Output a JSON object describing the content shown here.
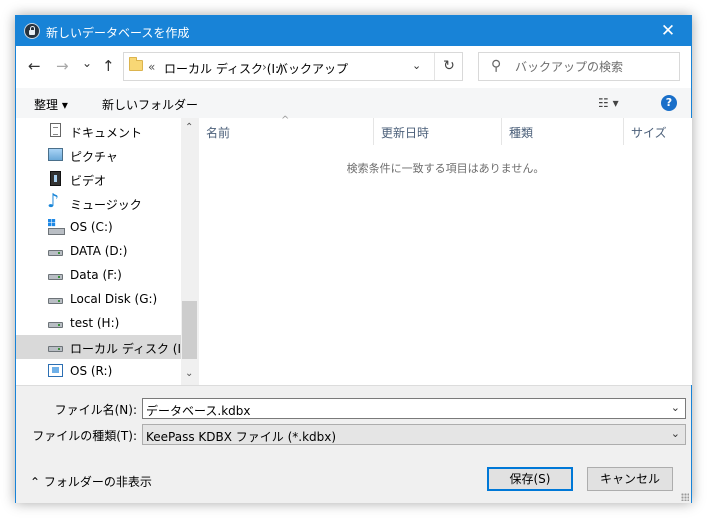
{
  "window": {
    "title": "新しいデータベースを作成",
    "close_icon": "close-icon"
  },
  "nav": {
    "back": "←",
    "forward": "→",
    "recent": "⌄",
    "up": "↑",
    "address": {
      "overflow": "«",
      "drive": "ローカル ディスク (I:)",
      "sep": "›",
      "folder": "バックアップ",
      "dropdown": "⌄",
      "refresh": "↻"
    },
    "search": {
      "placeholder": "バックアップの検索",
      "icon": "⚲"
    }
  },
  "toolbar": {
    "organize": "整理 ▾",
    "new_folder": "新しいフォルダー",
    "view": "☷ ▾",
    "help": "?"
  },
  "sidebar": {
    "items": [
      {
        "label": "ドキュメント",
        "icon": "document-icon"
      },
      {
        "label": "ピクチャ",
        "icon": "pictures-icon"
      },
      {
        "label": "ビデオ",
        "icon": "videos-icon"
      },
      {
        "label": "ミュージック",
        "icon": "music-icon"
      },
      {
        "label": "OS (C:)",
        "icon": "windows-drive-icon"
      },
      {
        "label": "DATA (D:)",
        "icon": "drive-icon"
      },
      {
        "label": "Data (F:)",
        "icon": "drive-icon"
      },
      {
        "label": "Local Disk (G:)",
        "icon": "drive-icon"
      },
      {
        "label": "test (H:)",
        "icon": "drive-icon"
      },
      {
        "label": "ローカル ディスク (I:)",
        "icon": "drive-icon",
        "selected": true
      },
      {
        "label": "OS (R:)",
        "icon": "network-drive-icon"
      }
    ],
    "scroll_up": "⌃",
    "scroll_down": "⌄"
  },
  "columns": [
    {
      "label": "名前"
    },
    {
      "label": "更新日時"
    },
    {
      "label": "種類"
    },
    {
      "label": "サイズ"
    }
  ],
  "sort_indicator": "^",
  "empty_message": "検索条件に一致する項目はありません。",
  "form": {
    "filename_label": "ファイル名(N):",
    "filename_value": "データベース.kdbx",
    "filetype_label": "ファイルの種類(T):",
    "filetype_value": "KeePass KDBX ファイル (*.kdbx)",
    "arrow": "⌄"
  },
  "footer": {
    "hide_folders": "⌃  フォルダーの非表示",
    "save": "保存(S)",
    "cancel": "キャンセル"
  }
}
